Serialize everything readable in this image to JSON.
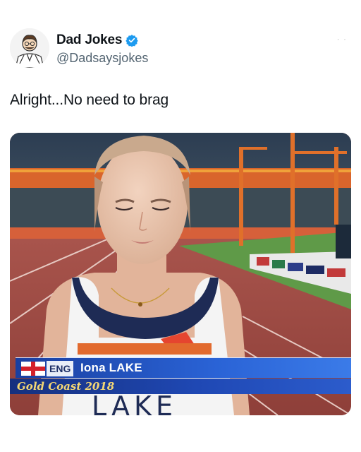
{
  "tweet": {
    "display_name": "Dad Jokes",
    "handle": "@Dadsaysjokes",
    "text": "Alright...No need to brag",
    "verified_icon": "verified-badge-icon",
    "avatar_icon": "dad-cartoon-avatar"
  },
  "media": {
    "lower_third": {
      "country": "ENG",
      "athlete_name": "Iona LAKE",
      "event": "Gold Coast 2018"
    },
    "bib_text": "LAKE"
  },
  "colors": {
    "verified_blue": "#1d9bf0",
    "handle_gray": "#536471",
    "graphic_blue": "#1f48b4",
    "graphic_gold": "#f4d774"
  }
}
